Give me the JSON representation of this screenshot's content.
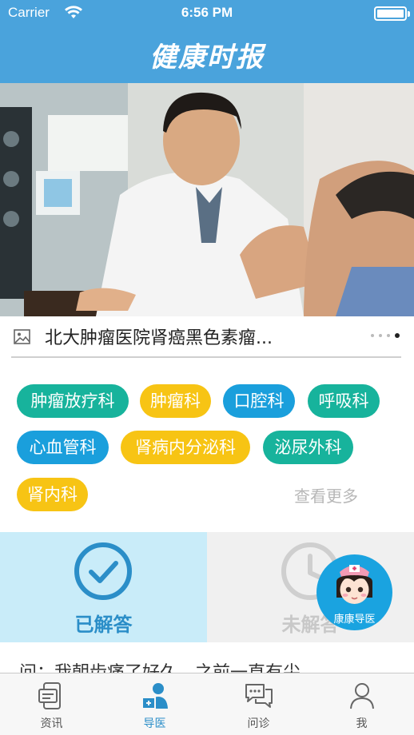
{
  "status_bar": {
    "carrier": "Carrier",
    "time": "6:56 PM",
    "battery_level": 1.0
  },
  "nav": {
    "title": "健康时报"
  },
  "banner": {
    "caption": "北大肿瘤医院肾癌黑色素瘤...",
    "caption_icon": "image-icon",
    "page_count": 4,
    "active_page": 4
  },
  "departments": {
    "tags": [
      {
        "label": "肿瘤放疗科",
        "color": "green"
      },
      {
        "label": "肿瘤科",
        "color": "orange"
      },
      {
        "label": "口腔科",
        "color": "blue"
      },
      {
        "label": "呼吸科",
        "color": "green"
      },
      {
        "label": "心血管科",
        "color": "blue"
      },
      {
        "label": "肾病内分泌科",
        "color": "orange"
      },
      {
        "label": "泌尿外科",
        "color": "green"
      },
      {
        "label": "肾内科",
        "color": "orange"
      }
    ],
    "see_more": "查看更多"
  },
  "answers": {
    "answered_label": "已解答",
    "answered_icon": "checkmark-circle-icon",
    "unanswered_label": "未解答",
    "unanswered_icon": "clock-icon"
  },
  "floating_button": {
    "label": "康康导医",
    "icon": "nurse-avatar-icon"
  },
  "question_preview": "问：我朝齿痛了好久，之前一直有尖",
  "tabs": [
    {
      "label": "资讯",
      "icon": "news-phone-icon",
      "active": false
    },
    {
      "label": "导医",
      "icon": "doctor-guide-icon",
      "active": true
    },
    {
      "label": "问诊",
      "icon": "chat-bubbles-icon",
      "active": false
    },
    {
      "label": "我",
      "icon": "person-icon",
      "active": false
    }
  ],
  "colors": {
    "primary": "#4aa3dc",
    "tag_green": "#17b39c",
    "tag_orange": "#f7c414",
    "tag_blue": "#1a9fdc",
    "answered_bg": "#c9ecf9",
    "answered_text": "#2b8ec8"
  }
}
